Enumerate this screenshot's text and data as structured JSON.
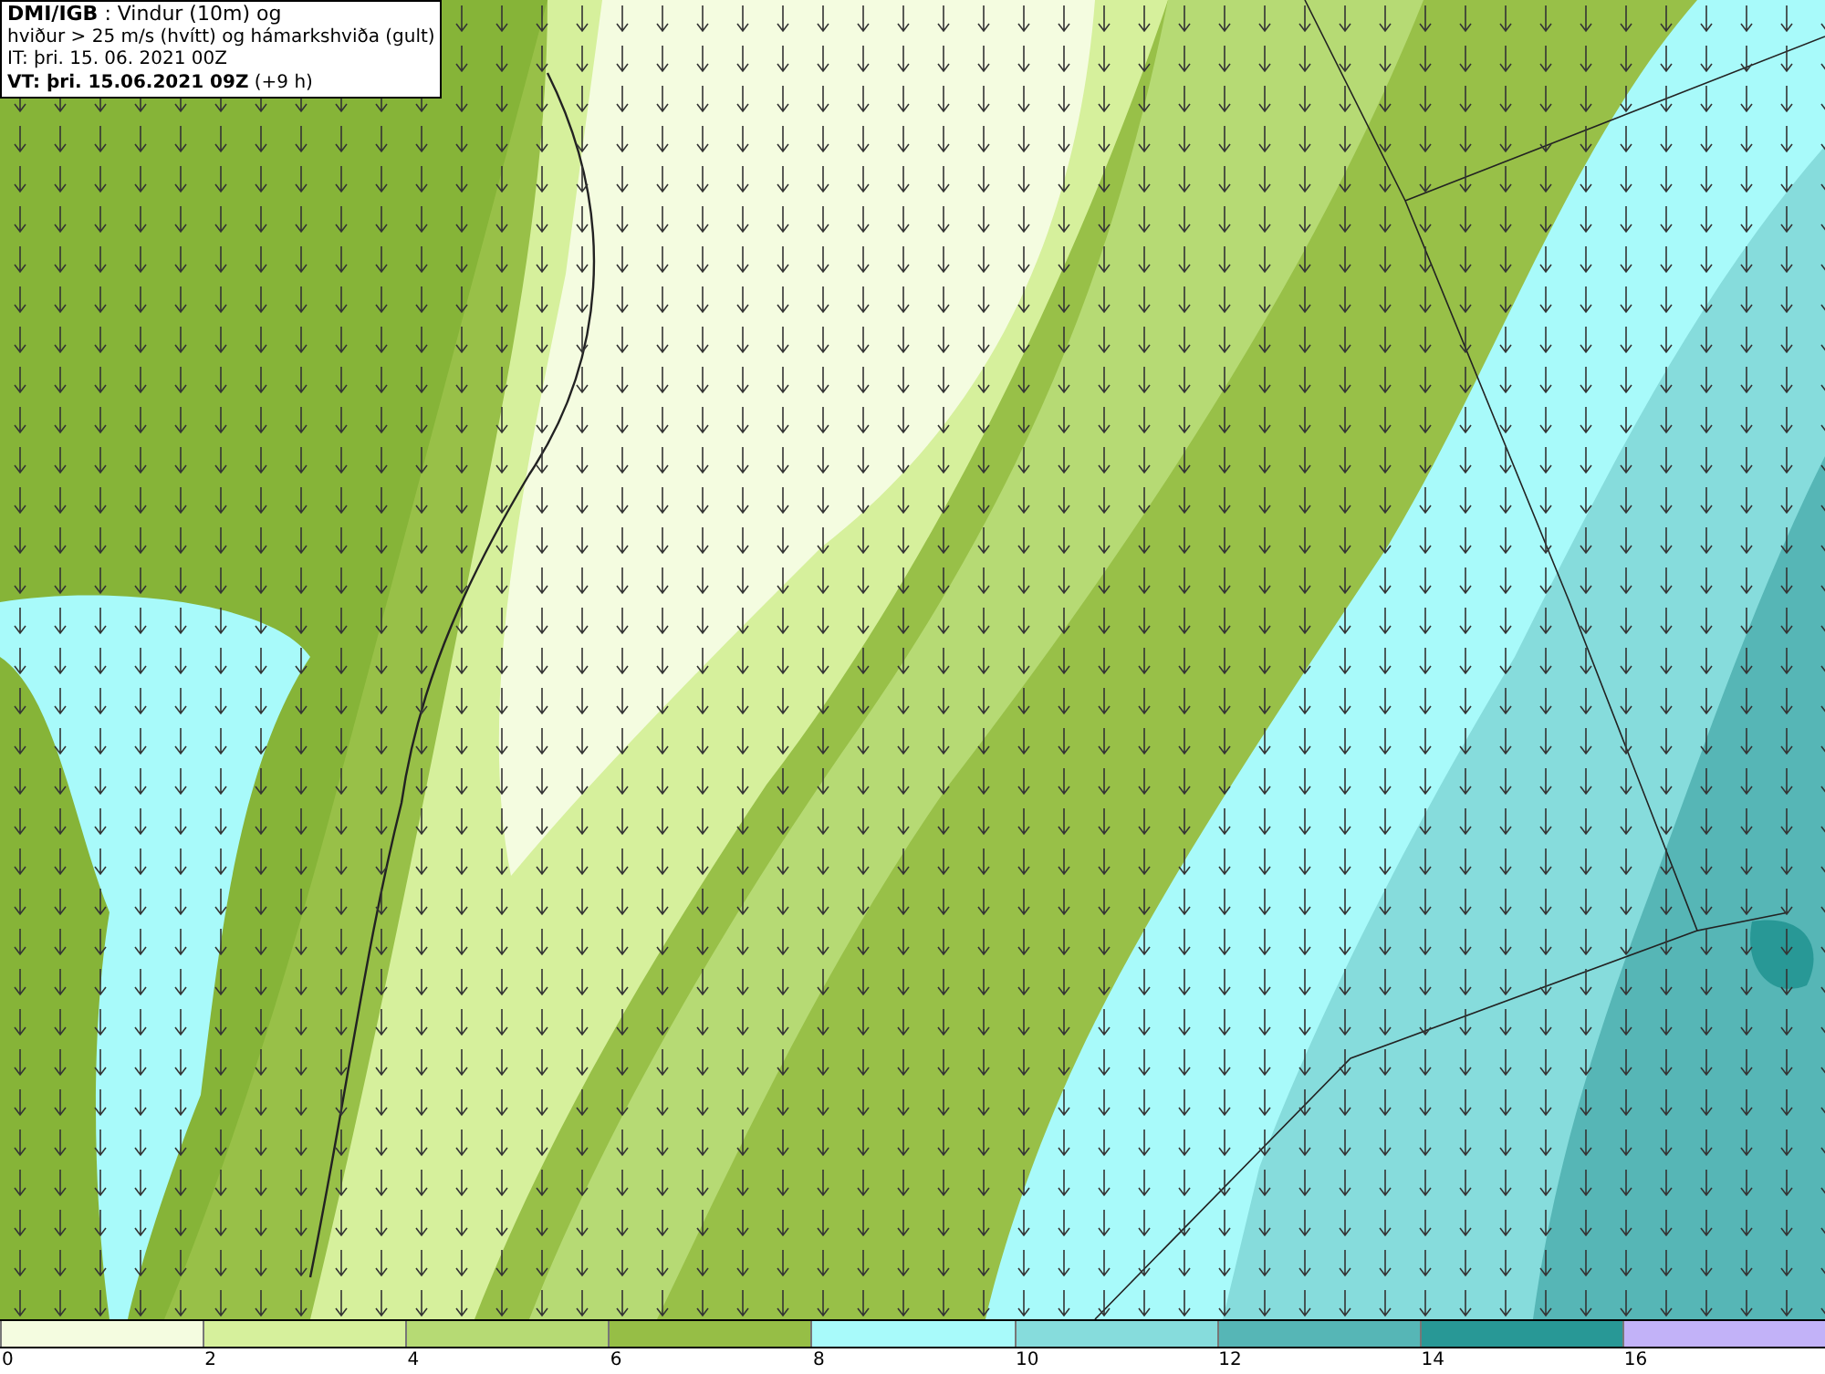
{
  "title_box": {
    "lines": [
      "**DMI/IGB** : Vindur (10m) og",
      "hviður > 25 m/s (hvítt) og hámarkshviða (gult)",
      "IT: þri. 15. 06. 2021 00Z",
      "**VT: þri. 15.06.2021 09Z** (+9 h)"
    ]
  },
  "legend": {
    "segments": [
      {
        "label": "0",
        "color": "#f4fce0"
      },
      {
        "label": "2",
        "color": "#d6f09c"
      },
      {
        "label": "4",
        "color": "#b6da74"
      },
      {
        "label": "6",
        "color": "#96be46"
      },
      {
        "label": "8",
        "color": "#a8fafa"
      },
      {
        "label": "10",
        "color": "#86dcdc"
      },
      {
        "label": "12",
        "color": "#56b6b6"
      },
      {
        "label": "14",
        "color": "#289896"
      },
      {
        "label": "16",
        "color": "#c2b2f8"
      }
    ]
  }
}
